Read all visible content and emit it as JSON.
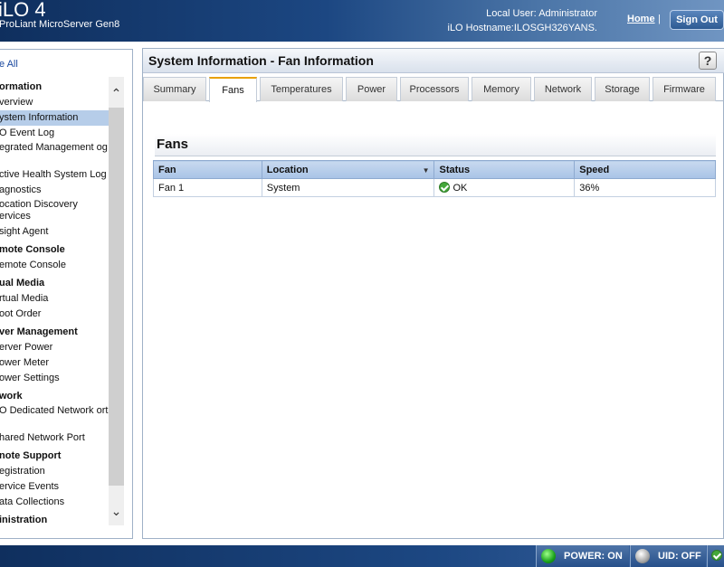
{
  "header": {
    "title": "iLO 4",
    "subtitle": "ProLiant MicroServer Gen8",
    "local_user_label": "Local User:",
    "local_user_value": "Administrator",
    "hostname_label": "iLO Hostname:",
    "hostname_value": "ILOSGH326YANS.",
    "home_link": "Home",
    "separator": "|",
    "signout_label": "Sign Out"
  },
  "sidebar": {
    "expand_all": "e All",
    "items": [
      {
        "label": "ormation",
        "type": "head"
      },
      {
        "label": "verview",
        "type": "item"
      },
      {
        "label": "ystem Information",
        "type": "item",
        "active": true
      },
      {
        "label": "O Event Log",
        "type": "item"
      },
      {
        "label": "egrated Management og",
        "type": "item2"
      },
      {
        "label": "ctive Health System Log",
        "type": "item"
      },
      {
        "label": "agnostics",
        "type": "item"
      },
      {
        "label": "ocation Discovery ervices",
        "type": "item2"
      },
      {
        "label": "sight Agent",
        "type": "item"
      },
      {
        "label": "mote Console",
        "type": "head"
      },
      {
        "label": "emote Console",
        "type": "item"
      },
      {
        "label": "ual Media",
        "type": "head"
      },
      {
        "label": "rtual Media",
        "type": "item"
      },
      {
        "label": "oot Order",
        "type": "item"
      },
      {
        "label": "ver Management",
        "type": "head"
      },
      {
        "label": "erver Power",
        "type": "item"
      },
      {
        "label": "ower Meter",
        "type": "item"
      },
      {
        "label": "ower Settings",
        "type": "item"
      },
      {
        "label": "work",
        "type": "head"
      },
      {
        "label": "O Dedicated Network ort",
        "type": "item2"
      },
      {
        "label": "hared Network Port",
        "type": "item"
      },
      {
        "label": "note Support",
        "type": "head"
      },
      {
        "label": "egistration",
        "type": "item"
      },
      {
        "label": "ervice Events",
        "type": "item"
      },
      {
        "label": "ata Collections",
        "type": "item"
      },
      {
        "label": "inistration",
        "type": "head"
      }
    ]
  },
  "main": {
    "panel_title": "System Information - Fan Information",
    "help_label": "?",
    "tabs": [
      {
        "label": "Summary"
      },
      {
        "label": "Fans",
        "active": true
      },
      {
        "label": "Temperatures"
      },
      {
        "label": "Power"
      },
      {
        "label": "Processors"
      },
      {
        "label": "Memory"
      },
      {
        "label": "Network"
      },
      {
        "label": "Storage"
      },
      {
        "label": "Firmware"
      }
    ],
    "section_title": "Fans",
    "table": {
      "headers": [
        "Fan",
        "Location",
        "Status",
        "Speed"
      ],
      "rows": [
        {
          "fan": "Fan 1",
          "location": "System",
          "status": "OK",
          "speed": "36%"
        }
      ]
    }
  },
  "footer": {
    "power_label": "POWER: ON",
    "uid_label": "UID: OFF"
  },
  "colors": {
    "header_dark": "#0f2f5e",
    "selected_item": "#b6cde9",
    "tab_accent": "#e9a100",
    "status_ok": "#44a83a"
  }
}
